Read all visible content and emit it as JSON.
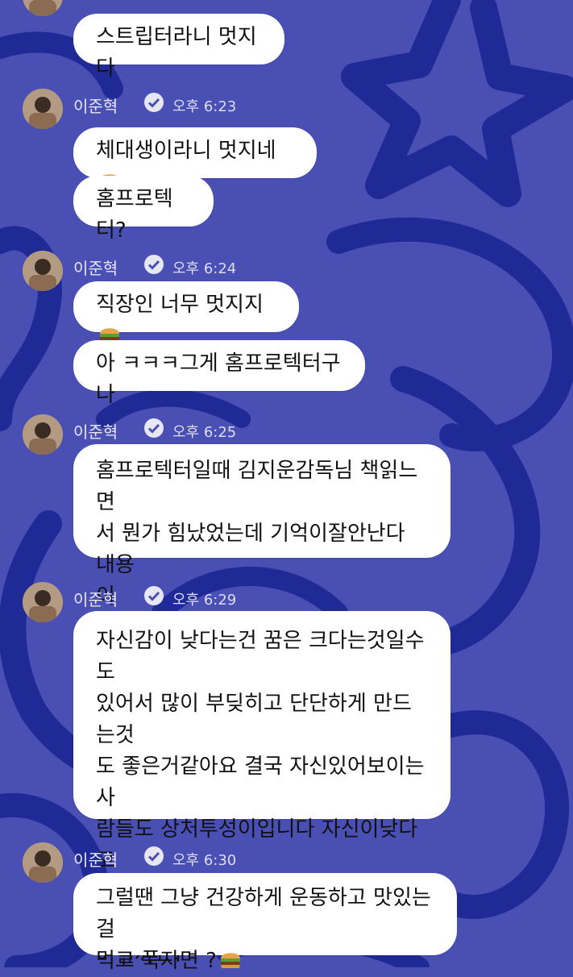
{
  "sender": {
    "name": "이준혁",
    "verified_icon": "verified-badge-icon",
    "avatar_icon": "profile-avatar"
  },
  "messages": [
    {
      "id": "m1",
      "text": "스트립터라니 멋지다",
      "emoji": false
    },
    {
      "id": "m2",
      "time": "오후 6:23",
      "text": "체대생이라니 멋지네",
      "emoji": true
    },
    {
      "id": "m3",
      "text": "홈프로텍터?",
      "emoji": false
    },
    {
      "id": "m4",
      "time": "오후 6:24",
      "text": "직장인 너무 멋지지",
      "emoji": true
    },
    {
      "id": "m5",
      "text": "아 ㅋㅋㅋ그게 홈프로텍터구나",
      "emoji": false
    },
    {
      "id": "m6",
      "time": "오후 6:25",
      "text": "홈프로텍터일때 김지운감독님 책읽느면\n서 뭔가 힘났었는데 기억이잘안난다 내용\n이",
      "emoji": false
    },
    {
      "id": "m7",
      "time": "오후 6:29",
      "text": "자신감이 낮다는건 꿈은 크다는것일수도\n있어서 많이 부딪히고 단단하게 만드는것\n도 좋은거같아요 결국 자신있어보이는 사\n람들도 상처투성이입니다 자신이낮다고\n생각하지말고 꿈이크다 생각해보는것은\n어떨까요?",
      "emoji": false
    },
    {
      "id": "m8",
      "time": "오후 6:30",
      "text": "그럴땐 그냥 건강하게 운동하고 맛있는걸\n먹고 푹자면 ?",
      "emoji": true
    }
  ],
  "colors": {
    "background": "#4a4fb4",
    "doodle": "#1f2a96",
    "bubble": "#ffffff"
  },
  "emoji_icon": "hamburger-emoji"
}
